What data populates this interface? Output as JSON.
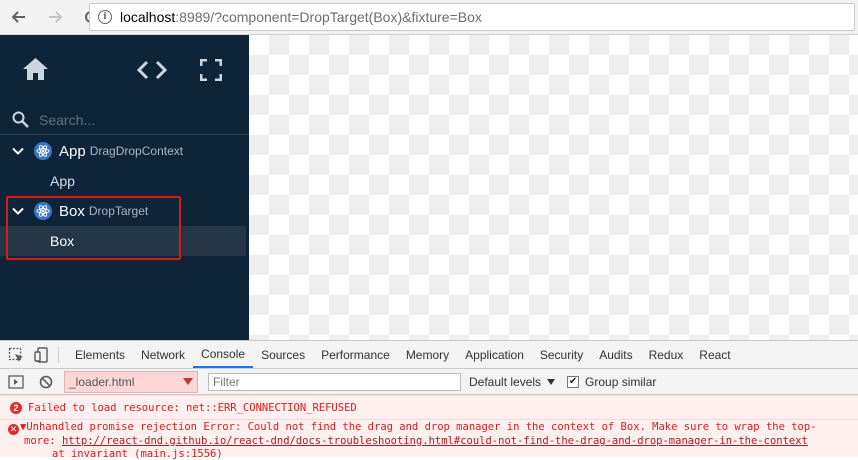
{
  "browser": {
    "url_host": "localhost",
    "url_rest": ":8989/?component=DropTarget(Box)&fixture=Box"
  },
  "sidebar": {
    "search_placeholder": "Search...",
    "groups": [
      {
        "name": "App",
        "sub": "DragDropContext",
        "children": [
          "App"
        ]
      },
      {
        "name": "Box",
        "sub": "DropTarget",
        "children": [
          "Box"
        ]
      }
    ]
  },
  "devtools": {
    "tabs": [
      "Elements",
      "Network",
      "Console",
      "Sources",
      "Performance",
      "Memory",
      "Application",
      "Security",
      "Audits",
      "Redux",
      "React"
    ],
    "active_tab": "Console",
    "context": "_loader.html",
    "filter_placeholder": "Filter",
    "levels_label": "Default levels",
    "group_similar_label": "Group similar",
    "group_similar_checked": true
  },
  "console": {
    "messages": [
      {
        "count": "2",
        "text": "Failed to load resource: net::ERR_CONNECTION_REFUSED"
      },
      {
        "text_line1": "▼Unhandled promise rejection Error: Could not find the drag and drop manager in the context of Box. Make sure to wrap the top-",
        "text_line2_prefix": "more: ",
        "text_line2_link": "http://react-dnd.github.io/react-dnd/docs-troubleshooting.html#could-not-find-the-drag-and-drop-manager-in-the-context",
        "text_line3": "at invariant (main.js:1556)"
      }
    ]
  },
  "colors": {
    "sidebar_bg": "#0e2539",
    "selected_bg": "#253646",
    "highlight": "#c92020",
    "error_text": "#e01a1a",
    "error_bg": "#fff0f0"
  }
}
